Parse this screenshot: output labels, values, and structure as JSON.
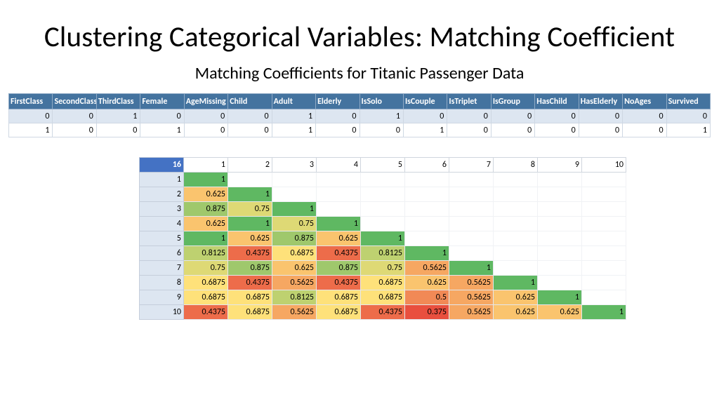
{
  "title": "Clustering Categorical Variables: Matching Coefficient",
  "subtitle": "Matching Coefficients for Titanic Passenger Data",
  "sample_table": {
    "columns": [
      "FirstClass",
      "SecondClass",
      "ThirdClass",
      "Female",
      "AgeMissing",
      "Child",
      "Adult",
      "Elderly",
      "IsSolo",
      "IsCouple",
      "IsTriplet",
      "IsGroup",
      "HasChild",
      "HasElderly",
      "NoAges",
      "Survived"
    ],
    "rows": [
      [
        0,
        0,
        1,
        0,
        0,
        0,
        1,
        0,
        1,
        0,
        0,
        0,
        0,
        0,
        0,
        0
      ],
      [
        1,
        0,
        0,
        1,
        0,
        0,
        1,
        0,
        0,
        1,
        0,
        0,
        0,
        0,
        0,
        1
      ]
    ]
  },
  "matrix": {
    "corner": "16",
    "col_headers": [
      "1",
      "2",
      "3",
      "4",
      "5",
      "6",
      "7",
      "8",
      "9",
      "10"
    ],
    "row_headers": [
      "1",
      "2",
      "3",
      "4",
      "5",
      "6",
      "7",
      "8",
      "9",
      "10"
    ],
    "cells": [
      [
        1
      ],
      [
        0.625,
        1
      ],
      [
        0.875,
        0.75,
        1
      ],
      [
        0.625,
        1,
        0.75,
        1
      ],
      [
        1,
        0.625,
        0.875,
        0.625,
        1
      ],
      [
        0.8125,
        0.4375,
        0.6875,
        0.4375,
        0.8125,
        1
      ],
      [
        0.75,
        0.875,
        0.625,
        0.875,
        0.75,
        0.5625,
        1
      ],
      [
        0.6875,
        0.4375,
        0.5625,
        0.4375,
        0.6875,
        0.625,
        0.5625,
        1
      ],
      [
        0.6875,
        0.6875,
        0.8125,
        0.6875,
        0.6875,
        0.5,
        0.5625,
        0.625,
        1
      ],
      [
        0.4375,
        0.6875,
        0.5625,
        0.6875,
        0.4375,
        0.375,
        0.5625,
        0.625,
        0.625,
        1
      ]
    ]
  },
  "chart_data": {
    "type": "heatmap",
    "title": "Matching Coefficients for Titanic Passenger Data",
    "xlabel": "",
    "ylabel": "",
    "x": [
      "1",
      "2",
      "3",
      "4",
      "5",
      "6",
      "7",
      "8",
      "9",
      "10"
    ],
    "y": [
      "1",
      "2",
      "3",
      "4",
      "5",
      "6",
      "7",
      "8",
      "9",
      "10"
    ],
    "values": [
      [
        1,
        null,
        null,
        null,
        null,
        null,
        null,
        null,
        null,
        null
      ],
      [
        0.625,
        1,
        null,
        null,
        null,
        null,
        null,
        null,
        null,
        null
      ],
      [
        0.875,
        0.75,
        1,
        null,
        null,
        null,
        null,
        null,
        null,
        null
      ],
      [
        0.625,
        1,
        0.75,
        1,
        null,
        null,
        null,
        null,
        null,
        null
      ],
      [
        1,
        0.625,
        0.875,
        0.625,
        1,
        null,
        null,
        null,
        null,
        null
      ],
      [
        0.8125,
        0.4375,
        0.6875,
        0.4375,
        0.8125,
        1,
        null,
        null,
        null,
        null
      ],
      [
        0.75,
        0.875,
        0.625,
        0.875,
        0.75,
        0.5625,
        1,
        null,
        null,
        null
      ],
      [
        0.6875,
        0.4375,
        0.5625,
        0.4375,
        0.6875,
        0.625,
        0.5625,
        1,
        null,
        null
      ],
      [
        0.6875,
        0.6875,
        0.8125,
        0.6875,
        0.6875,
        0.5,
        0.5625,
        0.625,
        1,
        null
      ],
      [
        0.4375,
        0.6875,
        0.5625,
        0.6875,
        0.4375,
        0.375,
        0.5625,
        0.625,
        0.625,
        1
      ]
    ],
    "color_scale": {
      "low": 0.375,
      "high": 1.0,
      "low_color": "#e94f3e",
      "mid_color": "#fee17a",
      "high_color": "#5fb862"
    }
  }
}
